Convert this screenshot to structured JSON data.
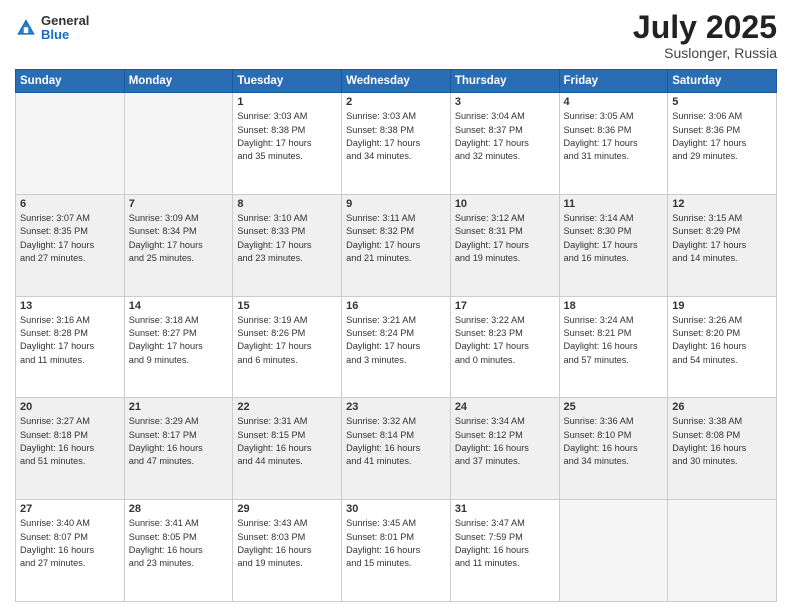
{
  "header": {
    "logo": {
      "general": "General",
      "blue": "Blue"
    },
    "title": "July 2025",
    "location": "Suslonger, Russia"
  },
  "weekdays": [
    "Sunday",
    "Monday",
    "Tuesday",
    "Wednesday",
    "Thursday",
    "Friday",
    "Saturday"
  ],
  "weeks": [
    [
      {
        "day": "",
        "info": ""
      },
      {
        "day": "",
        "info": ""
      },
      {
        "day": "1",
        "info": "Sunrise: 3:03 AM\nSunset: 8:38 PM\nDaylight: 17 hours\nand 35 minutes."
      },
      {
        "day": "2",
        "info": "Sunrise: 3:03 AM\nSunset: 8:38 PM\nDaylight: 17 hours\nand 34 minutes."
      },
      {
        "day": "3",
        "info": "Sunrise: 3:04 AM\nSunset: 8:37 PM\nDaylight: 17 hours\nand 32 minutes."
      },
      {
        "day": "4",
        "info": "Sunrise: 3:05 AM\nSunset: 8:36 PM\nDaylight: 17 hours\nand 31 minutes."
      },
      {
        "day": "5",
        "info": "Sunrise: 3:06 AM\nSunset: 8:36 PM\nDaylight: 17 hours\nand 29 minutes."
      }
    ],
    [
      {
        "day": "6",
        "info": "Sunrise: 3:07 AM\nSunset: 8:35 PM\nDaylight: 17 hours\nand 27 minutes."
      },
      {
        "day": "7",
        "info": "Sunrise: 3:09 AM\nSunset: 8:34 PM\nDaylight: 17 hours\nand 25 minutes."
      },
      {
        "day": "8",
        "info": "Sunrise: 3:10 AM\nSunset: 8:33 PM\nDaylight: 17 hours\nand 23 minutes."
      },
      {
        "day": "9",
        "info": "Sunrise: 3:11 AM\nSunset: 8:32 PM\nDaylight: 17 hours\nand 21 minutes."
      },
      {
        "day": "10",
        "info": "Sunrise: 3:12 AM\nSunset: 8:31 PM\nDaylight: 17 hours\nand 19 minutes."
      },
      {
        "day": "11",
        "info": "Sunrise: 3:14 AM\nSunset: 8:30 PM\nDaylight: 17 hours\nand 16 minutes."
      },
      {
        "day": "12",
        "info": "Sunrise: 3:15 AM\nSunset: 8:29 PM\nDaylight: 17 hours\nand 14 minutes."
      }
    ],
    [
      {
        "day": "13",
        "info": "Sunrise: 3:16 AM\nSunset: 8:28 PM\nDaylight: 17 hours\nand 11 minutes."
      },
      {
        "day": "14",
        "info": "Sunrise: 3:18 AM\nSunset: 8:27 PM\nDaylight: 17 hours\nand 9 minutes."
      },
      {
        "day": "15",
        "info": "Sunrise: 3:19 AM\nSunset: 8:26 PM\nDaylight: 17 hours\nand 6 minutes."
      },
      {
        "day": "16",
        "info": "Sunrise: 3:21 AM\nSunset: 8:24 PM\nDaylight: 17 hours\nand 3 minutes."
      },
      {
        "day": "17",
        "info": "Sunrise: 3:22 AM\nSunset: 8:23 PM\nDaylight: 17 hours\nand 0 minutes."
      },
      {
        "day": "18",
        "info": "Sunrise: 3:24 AM\nSunset: 8:21 PM\nDaylight: 16 hours\nand 57 minutes."
      },
      {
        "day": "19",
        "info": "Sunrise: 3:26 AM\nSunset: 8:20 PM\nDaylight: 16 hours\nand 54 minutes."
      }
    ],
    [
      {
        "day": "20",
        "info": "Sunrise: 3:27 AM\nSunset: 8:18 PM\nDaylight: 16 hours\nand 51 minutes."
      },
      {
        "day": "21",
        "info": "Sunrise: 3:29 AM\nSunset: 8:17 PM\nDaylight: 16 hours\nand 47 minutes."
      },
      {
        "day": "22",
        "info": "Sunrise: 3:31 AM\nSunset: 8:15 PM\nDaylight: 16 hours\nand 44 minutes."
      },
      {
        "day": "23",
        "info": "Sunrise: 3:32 AM\nSunset: 8:14 PM\nDaylight: 16 hours\nand 41 minutes."
      },
      {
        "day": "24",
        "info": "Sunrise: 3:34 AM\nSunset: 8:12 PM\nDaylight: 16 hours\nand 37 minutes."
      },
      {
        "day": "25",
        "info": "Sunrise: 3:36 AM\nSunset: 8:10 PM\nDaylight: 16 hours\nand 34 minutes."
      },
      {
        "day": "26",
        "info": "Sunrise: 3:38 AM\nSunset: 8:08 PM\nDaylight: 16 hours\nand 30 minutes."
      }
    ],
    [
      {
        "day": "27",
        "info": "Sunrise: 3:40 AM\nSunset: 8:07 PM\nDaylight: 16 hours\nand 27 minutes."
      },
      {
        "day": "28",
        "info": "Sunrise: 3:41 AM\nSunset: 8:05 PM\nDaylight: 16 hours\nand 23 minutes."
      },
      {
        "day": "29",
        "info": "Sunrise: 3:43 AM\nSunset: 8:03 PM\nDaylight: 16 hours\nand 19 minutes."
      },
      {
        "day": "30",
        "info": "Sunrise: 3:45 AM\nSunset: 8:01 PM\nDaylight: 16 hours\nand 15 minutes."
      },
      {
        "day": "31",
        "info": "Sunrise: 3:47 AM\nSunset: 7:59 PM\nDaylight: 16 hours\nand 11 minutes."
      },
      {
        "day": "",
        "info": ""
      },
      {
        "day": "",
        "info": ""
      }
    ]
  ]
}
